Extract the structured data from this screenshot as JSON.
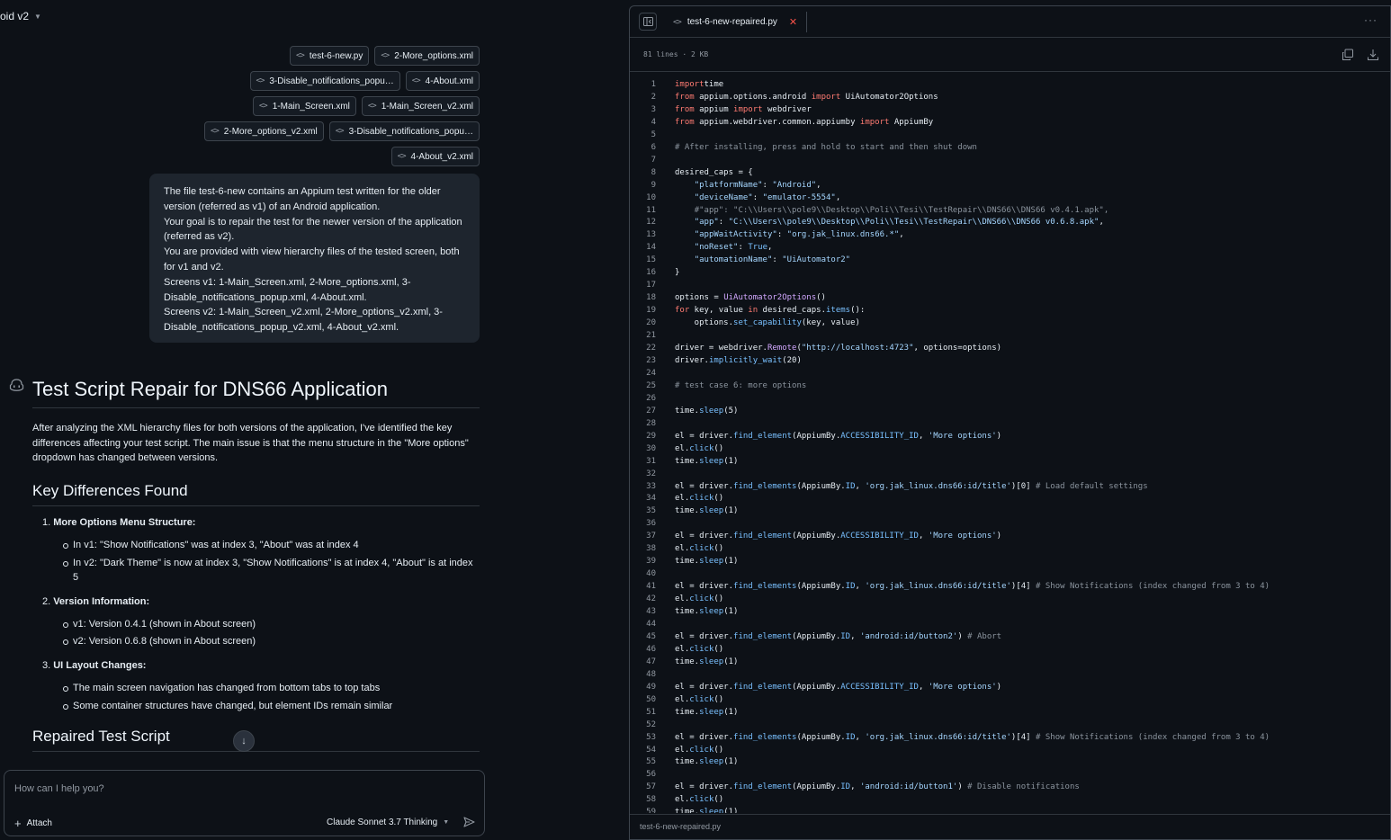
{
  "header": {
    "model_title": "oid v2"
  },
  "attachments": [
    [
      "test-6-new.py",
      "2-More_options.xml"
    ],
    [
      "3-Disable_notifications_popu…",
      "4-About.xml"
    ],
    [
      "1-Main_Screen.xml",
      "1-Main_Screen_v2.xml"
    ],
    [
      "2-More_options_v2.xml",
      "3-Disable_notifications_popu…"
    ],
    [
      "4-About_v2.xml"
    ]
  ],
  "user_message": [
    "The file test-6-new contains an Appium test written for the older version (referred as v1) of an Android application.",
    "Your goal is to repair the test for the newer version of the application (referred as v2).",
    "You are provided with view hierarchy files of the tested screen, both for v1 and v2.",
    "Screens v1: 1-Main_Screen.xml, 2-More_options.xml, 3-Disable_notifications_popup.xml, 4-About.xml.",
    "Screens v2: 1-Main_Screen_v2.xml, 2-More_options_v2.xml, 3-Disable_notifications_popup_v2.xml, 4-About_v2.xml."
  ],
  "answer": {
    "title": "Test Script Repair for DNS66 Application",
    "intro": "After analyzing the XML hierarchy files for both versions of the application, I've identified the key differences affecting your test script. The main issue is that the menu structure in the \"More options\" dropdown has changed between versions.",
    "section1": "Key Differences Found",
    "items": [
      {
        "num": "1.",
        "title": "More Options Menu Structure:",
        "bullets": [
          "In v1: \"Show Notifications\" was at index 3, \"About\" was at index 4",
          "In v2: \"Dark Theme\" is now at index 3, \"Show Notifications\" is at index 4, \"About\" is at index 5"
        ]
      },
      {
        "num": "2.",
        "title": "Version Information:",
        "bullets": [
          "v1: Version 0.4.1 (shown in About screen)",
          "v2: Version 0.6.8 (shown in About screen)"
        ]
      },
      {
        "num": "3.",
        "title": "UI Layout Changes:",
        "bullets": [
          "The main screen navigation has changed from bottom tabs to top tabs",
          "Some container structures have changed, but element IDs remain similar"
        ]
      }
    ],
    "section2": "Repaired Test Script"
  },
  "composer": {
    "placeholder": "How can I help you?",
    "attach_label": "Attach",
    "model_label": "Claude Sonnet 3.7 Thinking"
  },
  "code_panel": {
    "tab_label": "test-6-new-repaired.py",
    "meta": "81 lines · 2 KB",
    "status_filename": "test-6-new-repaired.py",
    "lines": [
      [
        [
          "kw",
          "import"
        ],
        [
          "",
          "time"
        ]
      ],
      [
        [
          "kw",
          "from"
        ],
        [
          "",
          " appium.options.android "
        ],
        [
          "kw",
          "import"
        ],
        [
          "",
          " UiAutomator2Options"
        ]
      ],
      [
        [
          "kw",
          "from"
        ],
        [
          "",
          " appium "
        ],
        [
          "kw",
          "import"
        ],
        [
          "",
          " webdriver"
        ]
      ],
      [
        [
          "kw",
          "from"
        ],
        [
          "",
          " appium.webdriver.common.appiumby "
        ],
        [
          "kw",
          "import"
        ],
        [
          "",
          " AppiumBy"
        ]
      ],
      [],
      [
        [
          "cm",
          "# After installing, press and hold to start and then shut down"
        ]
      ],
      [],
      [
        [
          "",
          "desired_caps = {"
        ]
      ],
      [
        [
          "",
          "    "
        ],
        [
          "st",
          "\"platformName\""
        ],
        [
          "",
          ": "
        ],
        [
          "st",
          "\"Android\""
        ],
        [
          "",
          ","
        ]
      ],
      [
        [
          "",
          "    "
        ],
        [
          "st",
          "\"deviceName\""
        ],
        [
          "",
          ": "
        ],
        [
          "st",
          "\"emulator-5554\""
        ],
        [
          "",
          ","
        ]
      ],
      [
        [
          "",
          "    "
        ],
        [
          "cm",
          "#\"app\": \"C:\\\\Users\\\\pole9\\\\Desktop\\\\Poli\\\\Tesi\\\\TestRepair\\\\DNS66\\\\DNS66 v0.4.1.apk\","
        ]
      ],
      [
        [
          "",
          "    "
        ],
        [
          "st",
          "\"app\""
        ],
        [
          "",
          ": "
        ],
        [
          "st",
          "\"C:\\\\Users\\\\pole9\\\\Desktop\\\\Poli\\\\Tesi\\\\TestRepair\\\\DNS66\\\\DNS66 v0.6.8.apk\""
        ],
        [
          "",
          ","
        ]
      ],
      [
        [
          "",
          "    "
        ],
        [
          "st",
          "\"appWaitActivity\""
        ],
        [
          "",
          ": "
        ],
        [
          "st",
          "\"org.jak_linux.dns66.*\""
        ],
        [
          "",
          ","
        ]
      ],
      [
        [
          "",
          "    "
        ],
        [
          "st",
          "\"noReset\""
        ],
        [
          "",
          ": "
        ],
        [
          "fn",
          "True"
        ],
        [
          "",
          ","
        ]
      ],
      [
        [
          "",
          "    "
        ],
        [
          "st",
          "\"automationName\""
        ],
        [
          "",
          ": "
        ],
        [
          "st",
          "\"UiAutomator2\""
        ]
      ],
      [
        [
          "",
          "}"
        ]
      ],
      [],
      [
        [
          "",
          "options = "
        ],
        [
          "cl",
          "UiAutomator2Options"
        ],
        [
          "",
          "()"
        ]
      ],
      [
        [
          "kw",
          "for"
        ],
        [
          "",
          " key, value "
        ],
        [
          "kw",
          "in"
        ],
        [
          "",
          " desired_caps."
        ],
        [
          "fn",
          "items"
        ],
        [
          "",
          "():"
        ]
      ],
      [
        [
          "",
          "    options."
        ],
        [
          "fn",
          "set_capability"
        ],
        [
          "",
          "(key, value)"
        ]
      ],
      [],
      [
        [
          "",
          "driver = webdriver."
        ],
        [
          "cl",
          "Remote"
        ],
        [
          "",
          "("
        ],
        [
          "st",
          "\"http://localhost:4723\""
        ],
        [
          "",
          ", options=options)"
        ]
      ],
      [
        [
          "",
          "driver."
        ],
        [
          "fn",
          "implicitly_wait"
        ],
        [
          "",
          "(20)"
        ]
      ],
      [],
      [
        [
          "cm",
          "# test case 6: more options"
        ]
      ],
      [],
      [
        [
          "",
          "time."
        ],
        [
          "fn",
          "sleep"
        ],
        [
          "",
          "(5)"
        ]
      ],
      [],
      [
        [
          "",
          "el = driver."
        ],
        [
          "fn",
          "find_element"
        ],
        [
          "",
          "(AppiumBy."
        ],
        [
          "fn",
          "ACCESSIBILITY_ID"
        ],
        [
          "",
          ", "
        ],
        [
          "st",
          "'More options'"
        ],
        [
          "",
          ")"
        ]
      ],
      [
        [
          "",
          "el."
        ],
        [
          "fn",
          "click"
        ],
        [
          "",
          "()"
        ]
      ],
      [
        [
          "",
          "time."
        ],
        [
          "fn",
          "sleep"
        ],
        [
          "",
          "(1)"
        ]
      ],
      [],
      [
        [
          "",
          "el = driver."
        ],
        [
          "fn",
          "find_elements"
        ],
        [
          "",
          "(AppiumBy."
        ],
        [
          "fn",
          "ID"
        ],
        [
          "",
          ", "
        ],
        [
          "st",
          "'org.jak_linux.dns66:id/title'"
        ],
        [
          "",
          ")[0] "
        ],
        [
          "cm",
          "# Load default settings"
        ]
      ],
      [
        [
          "",
          "el."
        ],
        [
          "fn",
          "click"
        ],
        [
          "",
          "()"
        ]
      ],
      [
        [
          "",
          "time."
        ],
        [
          "fn",
          "sleep"
        ],
        [
          "",
          "(1)"
        ]
      ],
      [],
      [
        [
          "",
          "el = driver."
        ],
        [
          "fn",
          "find_element"
        ],
        [
          "",
          "(AppiumBy."
        ],
        [
          "fn",
          "ACCESSIBILITY_ID"
        ],
        [
          "",
          ", "
        ],
        [
          "st",
          "'More options'"
        ],
        [
          "",
          ")"
        ]
      ],
      [
        [
          "",
          "el."
        ],
        [
          "fn",
          "click"
        ],
        [
          "",
          "()"
        ]
      ],
      [
        [
          "",
          "time."
        ],
        [
          "fn",
          "sleep"
        ],
        [
          "",
          "(1)"
        ]
      ],
      [],
      [
        [
          "",
          "el = driver."
        ],
        [
          "fn",
          "find_elements"
        ],
        [
          "",
          "(AppiumBy."
        ],
        [
          "fn",
          "ID"
        ],
        [
          "",
          ", "
        ],
        [
          "st",
          "'org.jak_linux.dns66:id/title'"
        ],
        [
          "",
          ")[4] "
        ],
        [
          "cm",
          "# Show Notifications (index changed from 3 to 4)"
        ]
      ],
      [
        [
          "",
          "el."
        ],
        [
          "fn",
          "click"
        ],
        [
          "",
          "()"
        ]
      ],
      [
        [
          "",
          "time."
        ],
        [
          "fn",
          "sleep"
        ],
        [
          "",
          "(1)"
        ]
      ],
      [],
      [
        [
          "",
          "el = driver."
        ],
        [
          "fn",
          "find_element"
        ],
        [
          "",
          "(AppiumBy."
        ],
        [
          "fn",
          "ID"
        ],
        [
          "",
          ", "
        ],
        [
          "st",
          "'android:id/button2'"
        ],
        [
          "",
          ") "
        ],
        [
          "cm",
          "# Abort"
        ]
      ],
      [
        [
          "",
          "el."
        ],
        [
          "fn",
          "click"
        ],
        [
          "",
          "()"
        ]
      ],
      [
        [
          "",
          "time."
        ],
        [
          "fn",
          "sleep"
        ],
        [
          "",
          "(1)"
        ]
      ],
      [],
      [
        [
          "",
          "el = driver."
        ],
        [
          "fn",
          "find_element"
        ],
        [
          "",
          "(AppiumBy."
        ],
        [
          "fn",
          "ACCESSIBILITY_ID"
        ],
        [
          "",
          ", "
        ],
        [
          "st",
          "'More options'"
        ],
        [
          "",
          ")"
        ]
      ],
      [
        [
          "",
          "el."
        ],
        [
          "fn",
          "click"
        ],
        [
          "",
          "()"
        ]
      ],
      [
        [
          "",
          "time."
        ],
        [
          "fn",
          "sleep"
        ],
        [
          "",
          "(1)"
        ]
      ],
      [],
      [
        [
          "",
          "el = driver."
        ],
        [
          "fn",
          "find_elements"
        ],
        [
          "",
          "(AppiumBy."
        ],
        [
          "fn",
          "ID"
        ],
        [
          "",
          ", "
        ],
        [
          "st",
          "'org.jak_linux.dns66:id/title'"
        ],
        [
          "",
          ")[4] "
        ],
        [
          "cm",
          "# Show Notifications (index changed from 3 to 4)"
        ]
      ],
      [
        [
          "",
          "el."
        ],
        [
          "fn",
          "click"
        ],
        [
          "",
          "()"
        ]
      ],
      [
        [
          "",
          "time."
        ],
        [
          "fn",
          "sleep"
        ],
        [
          "",
          "(1)"
        ]
      ],
      [],
      [
        [
          "",
          "el = driver."
        ],
        [
          "fn",
          "find_element"
        ],
        [
          "",
          "(AppiumBy."
        ],
        [
          "fn",
          "ID"
        ],
        [
          "",
          ", "
        ],
        [
          "st",
          "'android:id/button1'"
        ],
        [
          "",
          ") "
        ],
        [
          "cm",
          "# Disable notifications"
        ]
      ],
      [
        [
          "",
          "el."
        ],
        [
          "fn",
          "click"
        ],
        [
          "",
          "()"
        ]
      ],
      [
        [
          "",
          "time."
        ],
        [
          "fn",
          "sleep"
        ],
        [
          "",
          "(1)"
        ]
      ]
    ]
  },
  "colors": {
    "background": "#0d1117",
    "panel_border": "#3d444d",
    "keyword": "#ff7b72",
    "string": "#a5d6ff",
    "comment": "#8b949e",
    "close_x": "#f85149"
  }
}
